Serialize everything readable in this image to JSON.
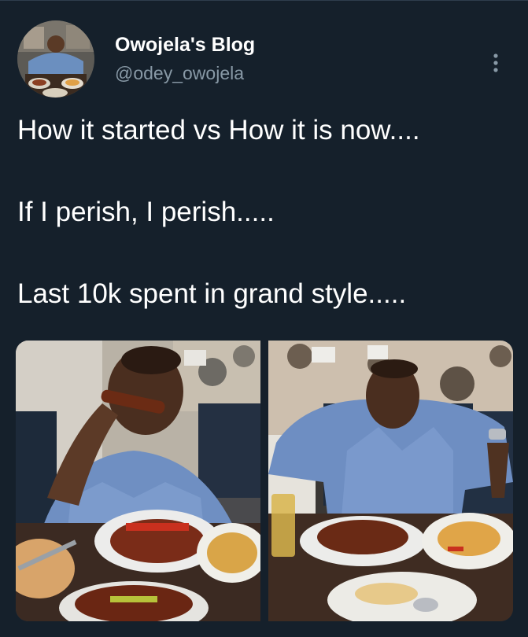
{
  "tweet": {
    "author": {
      "display_name": "Owojela's Blog",
      "handle": "@odey_owojela"
    },
    "text_lines": [
      "How it started vs How it is now....",
      "If I perish, I perish.....",
      "Last 10k spent in grand style....."
    ],
    "media": [
      {
        "subject": "man-eating-ribs"
      },
      {
        "subject": "man-leaning-back"
      }
    ]
  },
  "colors": {
    "background": "#15202b",
    "secondary_text": "#8899a6",
    "divider": "#2f3d4c"
  },
  "icons": {
    "more": "vertical-ellipsis-icon"
  }
}
